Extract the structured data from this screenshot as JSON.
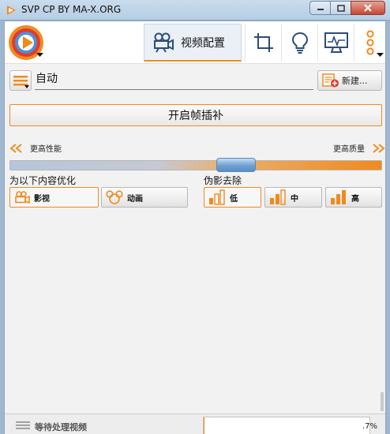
{
  "window": {
    "title": "SVP CP BY MA-X.ORG"
  },
  "header": {
    "active_tab_label": "视频配置",
    "tabs": [
      "video-settings",
      "crop",
      "tips",
      "monitor",
      "more"
    ]
  },
  "profile": {
    "name": "自动",
    "new_button_label": "新建..."
  },
  "frame_interpolation": {
    "button_label": "开启帧插补"
  },
  "quality_slider": {
    "left_label": "更高性能",
    "right_label": "更高质量",
    "position": 0.62
  },
  "optimize": {
    "label": "为以下内容优化",
    "options": [
      {
        "label": "影视",
        "selected": true
      },
      {
        "label": "动画",
        "selected": false
      }
    ]
  },
  "artifact_removal": {
    "label": "伪影去除",
    "options": [
      {
        "label": "低",
        "selected": true
      },
      {
        "label": "中",
        "selected": false
      },
      {
        "label": "高",
        "selected": false
      }
    ]
  },
  "status": {
    "text": "等待处理视频",
    "progress_text": ".7%",
    "progress_value": 0.007
  },
  "colors": {
    "accent": "#f08a1e",
    "thumb": "#6fa0d4"
  }
}
